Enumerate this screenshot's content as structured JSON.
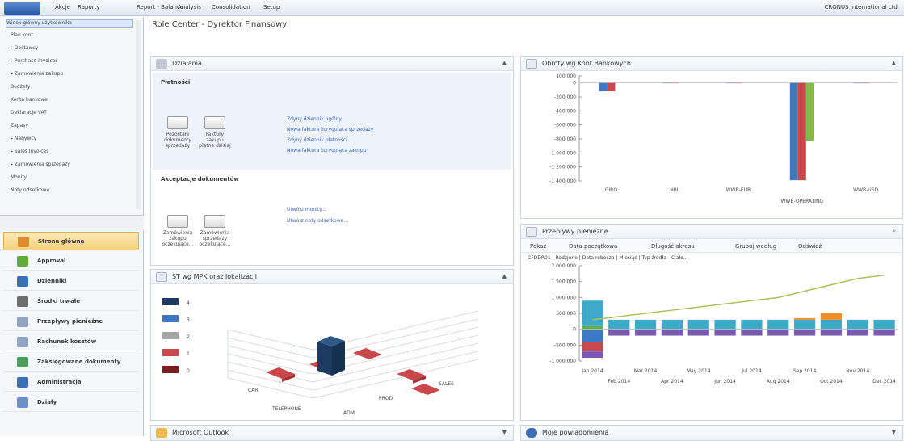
{
  "top": {
    "menu": [
      "Akcje",
      "Raporty",
      "Report - Balance",
      "Analysis",
      "Consolidation",
      "Setup"
    ],
    "company": "CRONUS International Ltd."
  },
  "nav_tree": [
    {
      "label": "Widok główny użytkownika",
      "selected": true
    },
    {
      "label": "Plan kont"
    },
    {
      "label": "Dostawcy",
      "expander": true
    },
    {
      "label": "Purchase Invoices",
      "expander": true
    },
    {
      "label": "Zamówienia zakupu",
      "expander": true
    },
    {
      "label": "Budżety"
    },
    {
      "label": "Konta bankowe"
    },
    {
      "label": "Deklaracje VAT"
    },
    {
      "label": "Zapasy"
    },
    {
      "label": "Nabywcy",
      "expander": true
    },
    {
      "label": "Sales Invoices",
      "expander": true
    },
    {
      "label": "Zamówienia sprzedaży",
      "expander": true
    },
    {
      "label": "Monity"
    },
    {
      "label": "Noty odsetkowe"
    }
  ],
  "nav_buttons": [
    {
      "label": "Strona główna",
      "active": true,
      "icon": "home-icon",
      "color": "#e08a2c"
    },
    {
      "label": "Approval",
      "icon": "approval-icon",
      "color": "#62a83a"
    },
    {
      "label": "Dzienniki",
      "icon": "journals-icon",
      "color": "#3d6fb4"
    },
    {
      "label": "Środki trwałe",
      "icon": "fixed-assets-icon",
      "color": "#6e6e6e"
    },
    {
      "label": "Przepływy pieniężne",
      "icon": "cash-flow-icon",
      "color": "#8fa5c2"
    },
    {
      "label": "Rachunek kosztów",
      "icon": "cost-accounting-icon",
      "color": "#8fa5c2"
    },
    {
      "label": "Zaksięgowane dokumenty",
      "icon": "posted-documents-icon",
      "color": "#4a9f5a"
    },
    {
      "label": "Administracja",
      "icon": "administration-icon",
      "color": "#3d6fb4"
    },
    {
      "label": "Działy",
      "icon": "departments-icon",
      "color": "#6d90c7"
    }
  ],
  "main": {
    "title": "Role Center - Dyrektor Finansowy"
  },
  "actions_panel": {
    "title": "Działania",
    "section1": "Płatności",
    "tiles1": [
      {
        "label": "Pozostałe dokumenty sprzedaży"
      },
      {
        "label": "Faktury zakupu płatne dzisiaj"
      }
    ],
    "links1": [
      "Zdyny dziennik ogólny",
      "Nowa faktura korygująca sprzedaży",
      "Zdyny dziennik płatności",
      "Nowa faktura korygująca zakupu"
    ],
    "section2": "Akceptacje dokumentów",
    "tiles2": [
      {
        "label": "Zamówienia zakupu oczekujące..."
      },
      {
        "label": "Zamówienia sprzedaży oczekujące..."
      }
    ],
    "links2": [
      "Utwórz monity...",
      "Utwórz noty odsetkowe..."
    ]
  },
  "st_panel": {
    "title": "ST wg MPK oraz lokalizacji",
    "legend": [
      {
        "label": "4",
        "color": "#1d3b60"
      },
      {
        "label": "3",
        "color": "#3f78c2"
      },
      {
        "label": "2",
        "color": "#a6a6a6"
      },
      {
        "label": "1",
        "color": "#c9484c"
      },
      {
        "label": "0",
        "color": "#7a1e1e"
      }
    ],
    "axis_labels": [
      "CAR",
      "TELEPHONE",
      "ADM",
      "PROD",
      "SALES"
    ]
  },
  "outlook_panel": {
    "title": "Microsoft Outlook"
  },
  "messages_panel": {
    "title": "Moje powiadomienia"
  },
  "bank_panel": {
    "title": "Obroty wg Kont Bankowych",
    "colors": [
      "#3f78c2",
      "#c9484c",
      "#86b848"
    ],
    "chart_data": {
      "type": "bar",
      "categories": [
        "GIRO",
        "NBL",
        "WWB-EUR",
        "WWB-OPERATING",
        "WWB-USD"
      ],
      "series": [
        {
          "values": [
            -120000,
            -5000,
            -5000,
            -1390000,
            -5000
          ]
        },
        {
          "values": [
            -120000,
            -5000,
            -5000,
            -1390000,
            -5000
          ]
        },
        {
          "values": [
            0,
            0,
            0,
            -830000,
            0
          ]
        }
      ],
      "ylim": [
        -1400000,
        100000
      ],
      "y_ticks": [
        "100 000",
        "0",
        "-200 000",
        "-400 000",
        "-600 000",
        "-800 000",
        "-1 000 000",
        "-1 200 000",
        "-1 400 000"
      ]
    }
  },
  "cashflow_panel": {
    "title": "Przepływy pieniężne",
    "toolbar": [
      "Pokaż",
      "Data początkowa",
      "Długość okresu",
      "Grupuj według",
      "Odśwież"
    ],
    "filter": "CFDDR01 | Rodzjone | Data robocza | Miesiąc | Typ źródła - Ciało...",
    "chart_data": {
      "type": "bar",
      "stacked": true,
      "categories": [
        "Jan 2014",
        "Feb 2014",
        "Mar 2014",
        "Apr 2014",
        "May 2014",
        "Jun 2014",
        "Jul 2014",
        "Aug 2014",
        "Sep 2014",
        "Oct 2014",
        "Nov 2014",
        "Dec 2014"
      ],
      "series": [
        {
          "color": "#5cb24a",
          "values": [
            100000,
            0,
            0,
            0,
            0,
            0,
            0,
            0,
            0,
            0,
            0,
            0
          ]
        },
        {
          "color": "#3fa9c9",
          "values": [
            800000,
            300000,
            300000,
            300000,
            300000,
            300000,
            300000,
            300000,
            300000,
            300000,
            300000,
            300000
          ]
        },
        {
          "color": "#ef8f2b",
          "values": [
            0,
            0,
            0,
            0,
            0,
            0,
            0,
            0,
            50000,
            200000,
            0,
            0
          ]
        },
        {
          "color": "#3f78c2",
          "values": [
            -400000,
            0,
            0,
            0,
            0,
            0,
            0,
            0,
            0,
            0,
            0,
            0
          ]
        },
        {
          "color": "#c9484c",
          "values": [
            -300000,
            0,
            0,
            0,
            0,
            0,
            0,
            0,
            0,
            0,
            0,
            0
          ]
        },
        {
          "color": "#7a58b4",
          "values": [
            -200000,
            -200000,
            -200000,
            -200000,
            -200000,
            -200000,
            -200000,
            -200000,
            -200000,
            -200000,
            -200000,
            -200000
          ]
        }
      ],
      "line": {
        "color": "#a8c15a",
        "values": [
          300000,
          400000,
          500000,
          600000,
          700000,
          800000,
          900000,
          1000000,
          1200000,
          1400000,
          1600000,
          1700000
        ]
      },
      "ylim": [
        -1000000,
        2000000
      ],
      "y_ticks": [
        "2 000 000",
        "1 500 000",
        "1 000 000",
        "500 000",
        "0",
        "-500 000",
        "-1 000 000"
      ],
      "x_labels_top": [
        "Jan 2014",
        "Mar 2014",
        "May 2014",
        "Jul 2014",
        "Sep 2014",
        "Nov 2014"
      ],
      "x_labels_bottom": [
        "Feb 2014",
        "Apr 2014",
        "Jun 2014",
        "Aug 2014",
        "Oct 2014",
        "Dec 2014"
      ]
    }
  }
}
